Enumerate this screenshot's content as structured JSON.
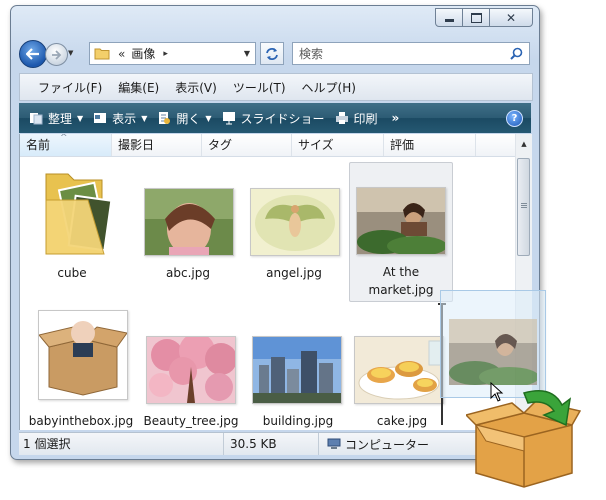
{
  "window": {
    "caption_buttons": [
      "minimize",
      "maximize",
      "close"
    ]
  },
  "address": {
    "chevron": "«",
    "location": "画像",
    "separator_arrow": "▸"
  },
  "search": {
    "placeholder": "検索"
  },
  "menu": [
    "ファイル(F)",
    "編集(E)",
    "表示(V)",
    "ツール(T)",
    "ヘルプ(H)"
  ],
  "toolbar": {
    "organize": "整理",
    "views": "表示",
    "open": "開く",
    "slideshow": "スライドショー",
    "print": "印刷",
    "more": "»"
  },
  "columns": [
    "名前",
    "撮影日",
    "タグ",
    "サイズ",
    "評価"
  ],
  "files": [
    {
      "name": "cube",
      "type": "folder"
    },
    {
      "name": "abc.jpg",
      "type": "image"
    },
    {
      "name": "angel.jpg",
      "type": "image"
    },
    {
      "name": "At the market.jpg",
      "type": "image",
      "selected": true
    },
    {
      "name": "babyinthebox.jpg",
      "type": "image"
    },
    {
      "name": "Beauty_tree.jpg",
      "type": "image"
    },
    {
      "name": "building.jpg",
      "type": "image"
    },
    {
      "name": "cake.jpg",
      "type": "image"
    }
  ],
  "status": {
    "selection": "1 個選択",
    "size": "30.5 KB",
    "location": "コンピューター"
  },
  "colors": {
    "accent": "#2b64b3",
    "command_bar": "#255872",
    "selection": "#eef0f3"
  },
  "icons": {
    "drop_target": "open-cardboard-box-icon",
    "drag_cursor": "arrow-cursor-icon"
  }
}
